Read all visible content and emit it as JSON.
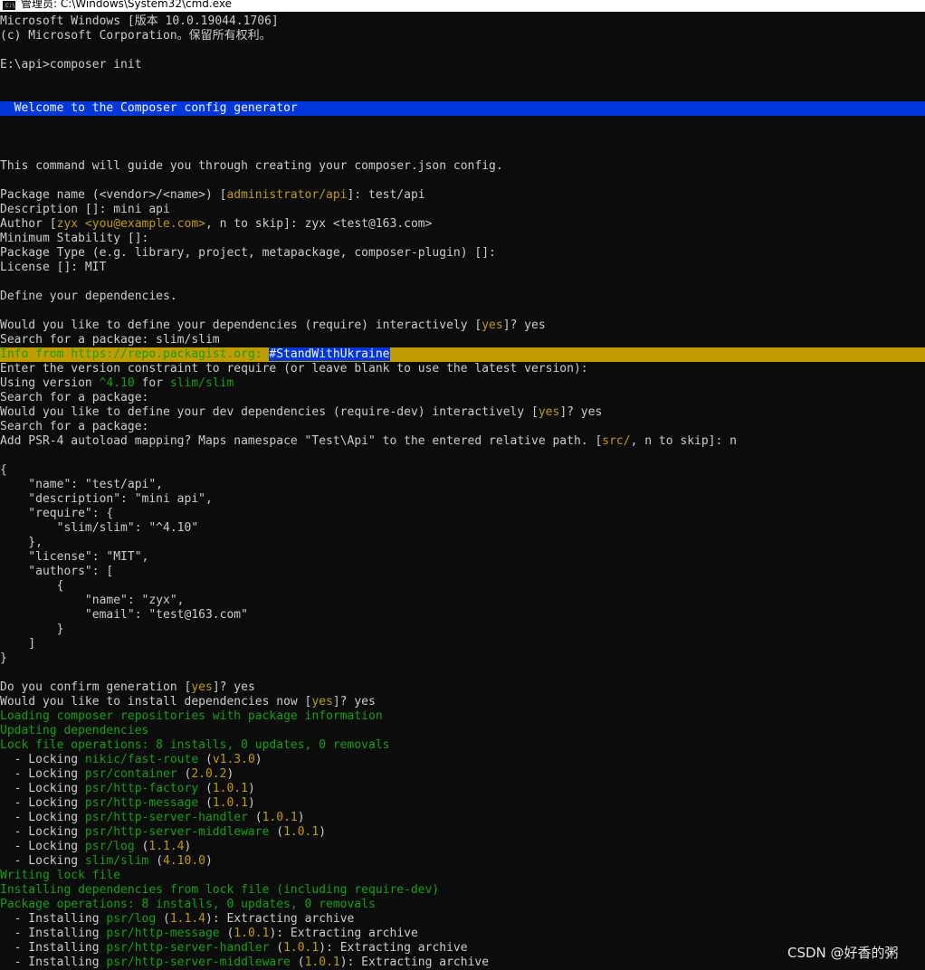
{
  "window": {
    "title": "管理员: C:\\Windows\\System32\\cmd.exe"
  },
  "watermark": "CSDN @好香的粥",
  "colors": {
    "background": "#0c0c0c",
    "text": "#cccccc",
    "yellow": "#c19c00",
    "green": "#13a10e",
    "blue": "#0037da"
  },
  "lines": [
    [
      {
        "t": "Microsoft Windows [版本 10.0.19044.1706]"
      }
    ],
    [
      {
        "t": "(c) Microsoft Corporation。保留所有权利。"
      }
    ],
    [],
    [
      {
        "t": "E:\\api>composer init"
      }
    ],
    [],
    [],
    [
      {
        "t": "  Welcome to the Composer config generator"
      }
    ],
    [],
    [],
    [],
    [
      {
        "t": "This command will guide you through creating your composer.json config."
      }
    ],
    [],
    [
      {
        "t": "Package name (<vendor>/<name>) ["
      },
      {
        "t": "administrator/api",
        "c": "y"
      },
      {
        "t": "]: test/api"
      }
    ],
    [
      {
        "t": "Description []: mini api"
      }
    ],
    [
      {
        "t": "Author ["
      },
      {
        "t": "zyx <you@example.com>",
        "c": "y"
      },
      {
        "t": ", n to skip]: zyx <test@163.com>"
      }
    ],
    [
      {
        "t": "Minimum Stability []:"
      }
    ],
    [
      {
        "t": "Package Type (e.g. library, project, metapackage, composer-plugin) []:"
      }
    ],
    [
      {
        "t": "License []: MIT"
      }
    ],
    [],
    [
      {
        "t": "Define your dependencies."
      }
    ],
    [],
    [
      {
        "t": "Would you like to define your dependencies (require) interactively ["
      },
      {
        "t": "yes",
        "c": "y"
      },
      {
        "t": "]? yes"
      }
    ],
    [
      {
        "t": "Search for a package: slim/slim"
      }
    ],
    [
      {
        "t": "Info from https://repo.packagist.org: ",
        "c": "g"
      },
      {
        "t": "#StandWith",
        "c": "hl"
      },
      {
        "t": "Ukraine",
        "c": "hlb"
      }
    ],
    [
      {
        "t": "Enter the version constraint to require (or leave blank to use the latest version):"
      }
    ],
    [
      {
        "t": "Using version "
      },
      {
        "t": "^4.10",
        "c": "g"
      },
      {
        "t": " for "
      },
      {
        "t": "slim/slim",
        "c": "g"
      }
    ],
    [
      {
        "t": "Search for a package:"
      }
    ],
    [
      {
        "t": "Would you like to define your dev dependencies (require-dev) interactively ["
      },
      {
        "t": "yes",
        "c": "y"
      },
      {
        "t": "]? yes"
      }
    ],
    [
      {
        "t": "Search for a package:"
      }
    ],
    [
      {
        "t": "Add PSR-4 autoload mapping? Maps namespace \"Test\\Api\" to the entered relative path. ["
      },
      {
        "t": "src/",
        "c": "y"
      },
      {
        "t": ", n to skip]: n"
      }
    ],
    [],
    [
      {
        "t": "{"
      }
    ],
    [
      {
        "t": "    \"name\": \"test/api\","
      }
    ],
    [
      {
        "t": "    \"description\": \"mini api\","
      }
    ],
    [
      {
        "t": "    \"require\": {"
      }
    ],
    [
      {
        "t": "        \"slim/slim\": \"^4.10\""
      }
    ],
    [
      {
        "t": "    },"
      }
    ],
    [
      {
        "t": "    \"license\": \"MIT\","
      }
    ],
    [
      {
        "t": "    \"authors\": ["
      }
    ],
    [
      {
        "t": "        {"
      }
    ],
    [
      {
        "t": "            \"name\": \"zyx\","
      }
    ],
    [
      {
        "t": "            \"email\": \"test@163.com\""
      }
    ],
    [
      {
        "t": "        }"
      }
    ],
    [
      {
        "t": "    ]"
      }
    ],
    [
      {
        "t": "}"
      }
    ],
    [],
    [
      {
        "t": "Do you confirm generation ["
      },
      {
        "t": "yes",
        "c": "y"
      },
      {
        "t": "]? yes"
      }
    ],
    [
      {
        "t": "Would you like to install dependencies now ["
      },
      {
        "t": "yes",
        "c": "y"
      },
      {
        "t": "]? yes"
      }
    ],
    [
      {
        "t": "Loading composer repositories with package information",
        "c": "g"
      }
    ],
    [
      {
        "t": "Updating dependencies",
        "c": "g"
      }
    ],
    [
      {
        "t": "Lock file operations: 8 installs, 0 updates, 0 removals",
        "c": "g"
      }
    ],
    [
      {
        "t": "  - Locking "
      },
      {
        "t": "nikic/fast-route",
        "c": "g"
      },
      {
        "t": " ("
      },
      {
        "t": "v1.3.0",
        "c": "y"
      },
      {
        "t": ")"
      }
    ],
    [
      {
        "t": "  - Locking "
      },
      {
        "t": "psr/container",
        "c": "g"
      },
      {
        "t": " ("
      },
      {
        "t": "2.0.2",
        "c": "y"
      },
      {
        "t": ")"
      }
    ],
    [
      {
        "t": "  - Locking "
      },
      {
        "t": "psr/http-factory",
        "c": "g"
      },
      {
        "t": " ("
      },
      {
        "t": "1.0.1",
        "c": "y"
      },
      {
        "t": ")"
      }
    ],
    [
      {
        "t": "  - Locking "
      },
      {
        "t": "psr/http-message",
        "c": "g"
      },
      {
        "t": " ("
      },
      {
        "t": "1.0.1",
        "c": "y"
      },
      {
        "t": ")"
      }
    ],
    [
      {
        "t": "  - Locking "
      },
      {
        "t": "psr/http-server-handler",
        "c": "g"
      },
      {
        "t": " ("
      },
      {
        "t": "1.0.1",
        "c": "y"
      },
      {
        "t": ")"
      }
    ],
    [
      {
        "t": "  - Locking "
      },
      {
        "t": "psr/http-server-middleware",
        "c": "g"
      },
      {
        "t": " ("
      },
      {
        "t": "1.0.1",
        "c": "y"
      },
      {
        "t": ")"
      }
    ],
    [
      {
        "t": "  - Locking "
      },
      {
        "t": "psr/log",
        "c": "g"
      },
      {
        "t": " ("
      },
      {
        "t": "1.1.4",
        "c": "y"
      },
      {
        "t": ")"
      }
    ],
    [
      {
        "t": "  - Locking "
      },
      {
        "t": "slim/slim",
        "c": "g"
      },
      {
        "t": " ("
      },
      {
        "t": "4.10.0",
        "c": "y"
      },
      {
        "t": ")"
      }
    ],
    [
      {
        "t": "Writing lock file",
        "c": "g"
      }
    ],
    [
      {
        "t": "Installing dependencies from lock file (including require-dev)",
        "c": "g"
      }
    ],
    [
      {
        "t": "Package operations: 8 installs, 0 updates, 0 removals",
        "c": "g"
      }
    ],
    [
      {
        "t": "  - Installing "
      },
      {
        "t": "psr/log",
        "c": "g"
      },
      {
        "t": " ("
      },
      {
        "t": "1.1.4",
        "c": "y"
      },
      {
        "t": "): Extracting archive"
      }
    ],
    [
      {
        "t": "  - Installing "
      },
      {
        "t": "psr/http-message",
        "c": "g"
      },
      {
        "t": " ("
      },
      {
        "t": "1.0.1",
        "c": "y"
      },
      {
        "t": "): Extracting archive"
      }
    ],
    [
      {
        "t": "  - Installing "
      },
      {
        "t": "psr/http-server-handler",
        "c": "g"
      },
      {
        "t": " ("
      },
      {
        "t": "1.0.1",
        "c": "y"
      },
      {
        "t": "): Extracting archive"
      }
    ],
    [
      {
        "t": "  - Installing "
      },
      {
        "t": "psr/http-server-middleware",
        "c": "g"
      },
      {
        "t": " ("
      },
      {
        "t": "1.0.1",
        "c": "y"
      },
      {
        "t": "): Extracting archive"
      }
    ]
  ]
}
